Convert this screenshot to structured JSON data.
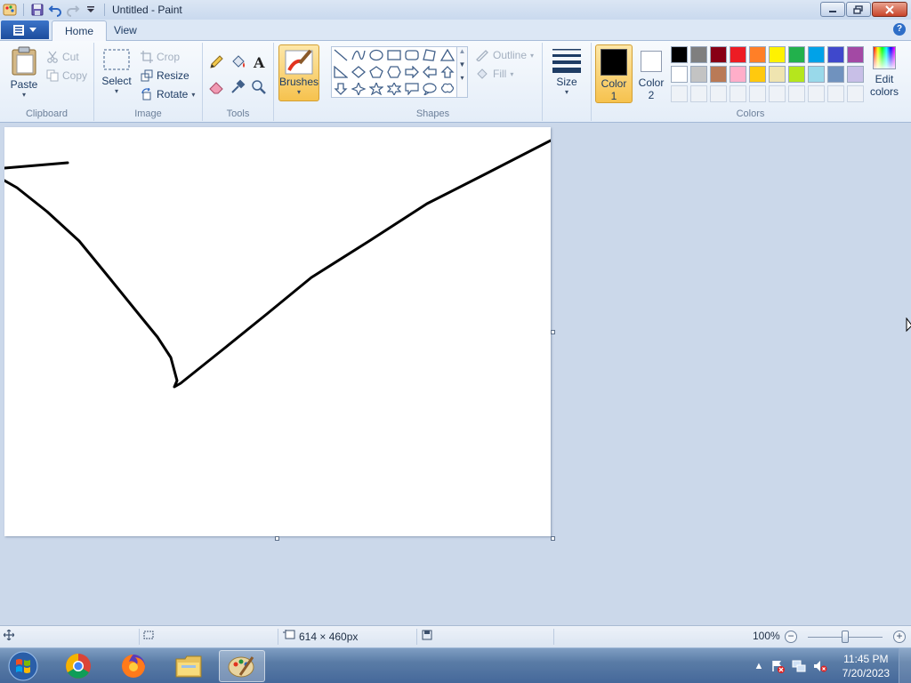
{
  "window": {
    "title": "Untitled - Paint"
  },
  "tabs": {
    "home": "Home",
    "view": "View"
  },
  "ribbon": {
    "clipboard": {
      "label": "Clipboard",
      "paste": "Paste",
      "cut": "Cut",
      "copy": "Copy"
    },
    "image": {
      "label": "Image",
      "select": "Select",
      "crop": "Crop",
      "resize": "Resize",
      "rotate": "Rotate"
    },
    "tools": {
      "label": "Tools"
    },
    "brushes": {
      "label": "Brushes"
    },
    "shapes": {
      "label": "Shapes",
      "outline": "Outline",
      "fill": "Fill"
    },
    "size": {
      "label": "Size"
    },
    "colors": {
      "label": "Colors",
      "color1_line1": "Color",
      "color1_line2": "1",
      "color2_line1": "Color",
      "color2_line2": "2",
      "edit_line1": "Edit",
      "edit_line2": "colors",
      "color1_value": "#000000",
      "color2_value": "#ffffff",
      "palette_row1": [
        "#000000",
        "#7f7f7f",
        "#880015",
        "#ed1c24",
        "#ff7f27",
        "#fff200",
        "#22b14c",
        "#00a2e8",
        "#3f48cc",
        "#a349a4"
      ],
      "palette_row2": [
        "#ffffff",
        "#c3c3c3",
        "#b97a57",
        "#ffaec9",
        "#ffc90e",
        "#efe4b0",
        "#b5e61d",
        "#99d9ea",
        "#7092be",
        "#c8bfe7"
      ]
    }
  },
  "status": {
    "canvas_size": "614 × 460px",
    "zoom": "100%",
    "zoom_level": 0.5
  },
  "taskbar": {
    "time": "11:45 PM",
    "date": "7/20/2023"
  }
}
